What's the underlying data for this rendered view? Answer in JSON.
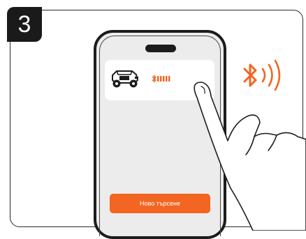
{
  "step": {
    "number": "3"
  },
  "device_list": {
    "items": [
      {
        "icon": "mower-icon",
        "status_icon": "bluetooth-icon",
        "signal": "signal-bars"
      }
    ]
  },
  "actions": {
    "new_search_label": "Ново търсене"
  },
  "icons": {
    "broadcast": "bluetooth-signal-icon",
    "gesture": "tapping-hand-icon"
  },
  "colors": {
    "accent": "#f26522",
    "outline": "#1c1c1c",
    "screen": "#ececec"
  }
}
